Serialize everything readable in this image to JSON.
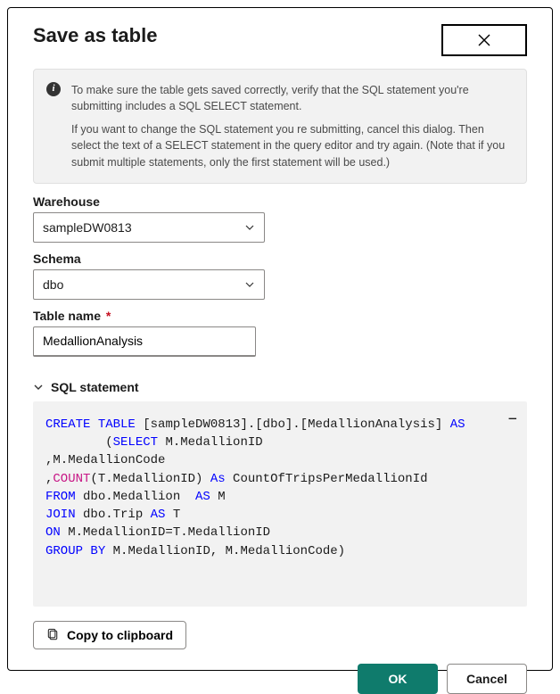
{
  "header": {
    "title": "Save as table"
  },
  "info": {
    "p1": "To make sure the table gets saved correctly, verify that the SQL statement you're submitting includes a SQL SELECT statement.",
    "p2": "If you want to change the SQL statement you re submitting, cancel this dialog. Then select the text of a SELECT statement in the query editor and try again. (Note that if you submit multiple statements, only the first statement will be used.)"
  },
  "fields": {
    "warehouse_label": "Warehouse",
    "warehouse_value": "sampleDW0813",
    "schema_label": "Schema",
    "schema_value": "dbo",
    "table_label": "Table name",
    "table_value": "MedallionAnalysis"
  },
  "sql": {
    "section_label": "SQL statement",
    "tokens": [
      {
        "t": "CREATE",
        "c": "kw-blue"
      },
      {
        "t": " "
      },
      {
        "t": "TABLE",
        "c": "kw-blue"
      },
      {
        "t": " [sampleDW0813].[dbo].[MedallionAnalysis] "
      },
      {
        "t": "AS",
        "c": "kw-blue"
      },
      {
        "t": "\n"
      },
      {
        "t": "        ("
      },
      {
        "t": "SELECT",
        "c": "kw-blue"
      },
      {
        "t": " M.MedallionID\n"
      },
      {
        "t": ",M.MedallionCode\n"
      },
      {
        "t": ","
      },
      {
        "t": "COUNT",
        "c": "kw-magenta"
      },
      {
        "t": "(T.MedallionID) "
      },
      {
        "t": "As",
        "c": "kw-blue"
      },
      {
        "t": " CountOfTripsPerMedallionId\n"
      },
      {
        "t": "FROM",
        "c": "kw-blue"
      },
      {
        "t": " dbo.Medallion  "
      },
      {
        "t": "AS",
        "c": "kw-blue"
      },
      {
        "t": " M\n"
      },
      {
        "t": "JOIN",
        "c": "kw-blue"
      },
      {
        "t": " dbo.Trip "
      },
      {
        "t": "AS",
        "c": "kw-blue"
      },
      {
        "t": " T\n"
      },
      {
        "t": "ON",
        "c": "kw-blue"
      },
      {
        "t": " M.MedallionID=T.MedallionID\n"
      },
      {
        "t": "GROUP",
        "c": "kw-blue"
      },
      {
        "t": " "
      },
      {
        "t": "BY",
        "c": "kw-blue"
      },
      {
        "t": " M.MedallionID, M.MedallionCode)"
      }
    ]
  },
  "buttons": {
    "copy": "Copy to clipboard",
    "ok": "OK",
    "cancel": "Cancel"
  }
}
